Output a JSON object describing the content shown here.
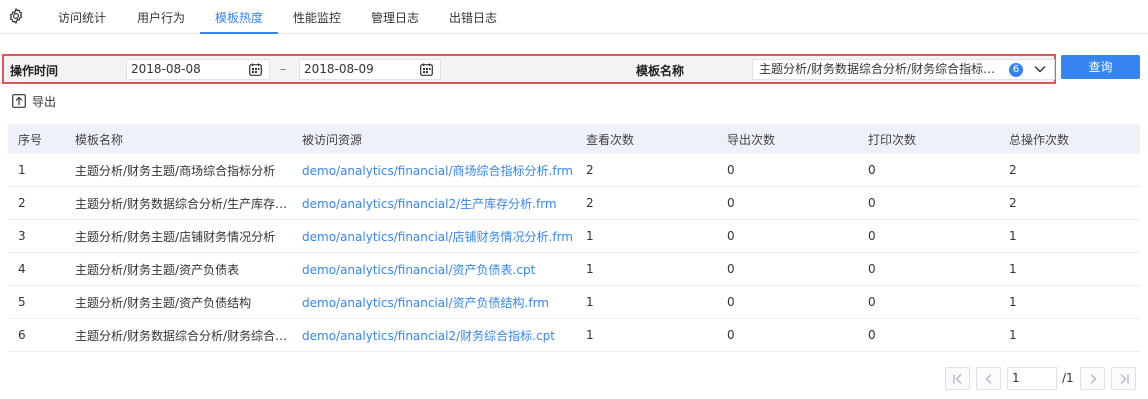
{
  "tabs": [
    {
      "label": "访问统计",
      "active": false
    },
    {
      "label": "用户行为",
      "active": false
    },
    {
      "label": "模板热度",
      "active": true
    },
    {
      "label": "性能监控",
      "active": false
    },
    {
      "label": "管理日志",
      "active": false
    },
    {
      "label": "出错日志",
      "active": false
    }
  ],
  "filter": {
    "time_label": "操作时间",
    "start_date": "2018-08-08",
    "separator": "–",
    "end_date": "2018-08-09",
    "template_label": "模板名称",
    "template_value": "主题分析/财务数据综合分析/财务综合指标…",
    "selected_count": "6",
    "query_label": "查询"
  },
  "export_label": "导出",
  "table": {
    "headers": [
      "序号",
      "模板名称",
      "被访问资源",
      "查看次数",
      "导出次数",
      "打印次数",
      "总操作次数"
    ],
    "rows": [
      [
        "1",
        "主题分析/财务主题/商场综合指标分析",
        "demo/analytics/financial/商场综合指标分析.frm",
        "2",
        "0",
        "0",
        "2"
      ],
      [
        "2",
        "主题分析/财务数据综合分析/生产库存…",
        "demo/analytics/financial2/生产库存分析.frm",
        "2",
        "0",
        "0",
        "2"
      ],
      [
        "3",
        "主题分析/财务主题/店铺财务情况分析",
        "demo/analytics/financial/店铺财务情况分析.frm",
        "1",
        "0",
        "0",
        "1"
      ],
      [
        "4",
        "主题分析/财务主题/资产负债表",
        "demo/analytics/financial/资产负债表.cpt",
        "1",
        "0",
        "0",
        "1"
      ],
      [
        "5",
        "主题分析/财务主题/资产负债结构",
        "demo/analytics/financial/资产负债结构.frm",
        "1",
        "0",
        "0",
        "1"
      ],
      [
        "6",
        "主题分析/财务数据综合分析/财务综合…",
        "demo/analytics/financial2/财务综合指标.cpt",
        "1",
        "0",
        "0",
        "1"
      ]
    ]
  },
  "pagination": {
    "current_page": "1",
    "total_label": "/1"
  },
  "colors": {
    "accent": "#3685f2",
    "highlight_border": "#e0555a"
  },
  "icons": [
    "gear-icon",
    "calendar-icon",
    "chevron-down-icon",
    "export-icon",
    "first-page-icon",
    "prev-page-icon",
    "next-page-icon",
    "last-page-icon"
  ]
}
